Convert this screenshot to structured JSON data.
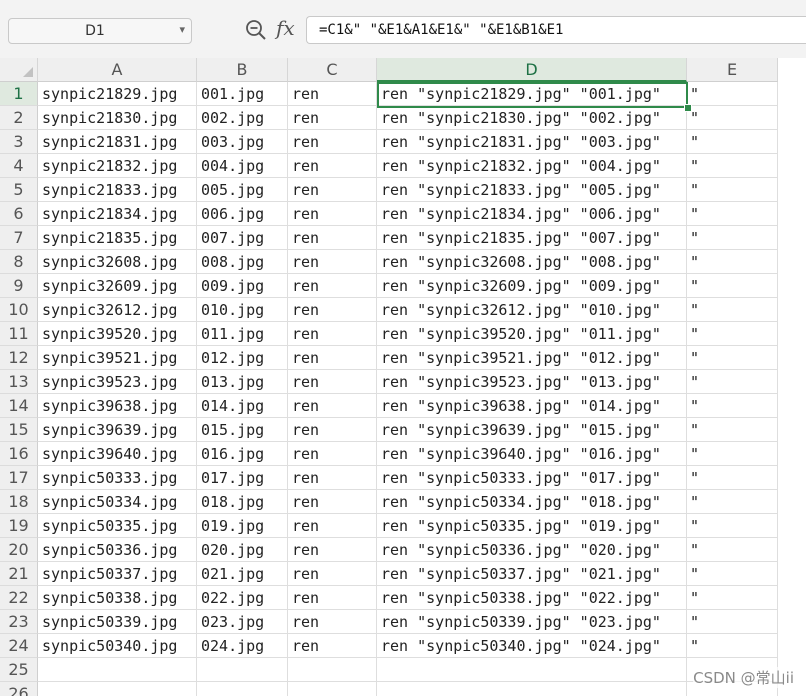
{
  "formula_bar": {
    "name_box": "D1",
    "formula": "=C1&\" \"&E1&A1&E1&\" \"&E1&B1&E1"
  },
  "columns": [
    "A",
    "B",
    "C",
    "D",
    "E"
  ],
  "selected_column": "D",
  "selected_row": "1",
  "rows": [
    {
      "n": "1",
      "a": "synpic21829.jpg",
      "b": "001.jpg",
      "c": "ren",
      "d": "ren \"synpic21829.jpg\" \"001.jpg\"",
      "e": "\""
    },
    {
      "n": "2",
      "a": "synpic21830.jpg",
      "b": "002.jpg",
      "c": "ren",
      "d": "ren \"synpic21830.jpg\" \"002.jpg\"",
      "e": "\""
    },
    {
      "n": "3",
      "a": "synpic21831.jpg",
      "b": "003.jpg",
      "c": "ren",
      "d": "ren \"synpic21831.jpg\" \"003.jpg\"",
      "e": "\""
    },
    {
      "n": "4",
      "a": "synpic21832.jpg",
      "b": "004.jpg",
      "c": "ren",
      "d": "ren \"synpic21832.jpg\" \"004.jpg\"",
      "e": "\""
    },
    {
      "n": "5",
      "a": "synpic21833.jpg",
      "b": "005.jpg",
      "c": "ren",
      "d": "ren \"synpic21833.jpg\" \"005.jpg\"",
      "e": "\""
    },
    {
      "n": "6",
      "a": "synpic21834.jpg",
      "b": "006.jpg",
      "c": "ren",
      "d": "ren \"synpic21834.jpg\" \"006.jpg\"",
      "e": "\""
    },
    {
      "n": "7",
      "a": "synpic21835.jpg",
      "b": "007.jpg",
      "c": "ren",
      "d": "ren \"synpic21835.jpg\" \"007.jpg\"",
      "e": "\""
    },
    {
      "n": "8",
      "a": "synpic32608.jpg",
      "b": "008.jpg",
      "c": "ren",
      "d": "ren \"synpic32608.jpg\" \"008.jpg\"",
      "e": "\""
    },
    {
      "n": "9",
      "a": "synpic32609.jpg",
      "b": "009.jpg",
      "c": "ren",
      "d": "ren \"synpic32609.jpg\" \"009.jpg\"",
      "e": "\""
    },
    {
      "n": "10",
      "a": "synpic32612.jpg",
      "b": "010.jpg",
      "c": "ren",
      "d": "ren \"synpic32612.jpg\" \"010.jpg\"",
      "e": "\""
    },
    {
      "n": "11",
      "a": "synpic39520.jpg",
      "b": "011.jpg",
      "c": "ren",
      "d": "ren \"synpic39520.jpg\" \"011.jpg\"",
      "e": "\""
    },
    {
      "n": "12",
      "a": "synpic39521.jpg",
      "b": "012.jpg",
      "c": "ren",
      "d": "ren \"synpic39521.jpg\" \"012.jpg\"",
      "e": "\""
    },
    {
      "n": "13",
      "a": "synpic39523.jpg",
      "b": "013.jpg",
      "c": "ren",
      "d": "ren \"synpic39523.jpg\" \"013.jpg\"",
      "e": "\""
    },
    {
      "n": "14",
      "a": "synpic39638.jpg",
      "b": "014.jpg",
      "c": "ren",
      "d": "ren \"synpic39638.jpg\" \"014.jpg\"",
      "e": "\""
    },
    {
      "n": "15",
      "a": "synpic39639.jpg",
      "b": "015.jpg",
      "c": "ren",
      "d": "ren \"synpic39639.jpg\" \"015.jpg\"",
      "e": "\""
    },
    {
      "n": "16",
      "a": "synpic39640.jpg",
      "b": "016.jpg",
      "c": "ren",
      "d": "ren \"synpic39640.jpg\" \"016.jpg\"",
      "e": "\""
    },
    {
      "n": "17",
      "a": "synpic50333.jpg",
      "b": "017.jpg",
      "c": "ren",
      "d": "ren \"synpic50333.jpg\" \"017.jpg\"",
      "e": "\""
    },
    {
      "n": "18",
      "a": "synpic50334.jpg",
      "b": "018.jpg",
      "c": "ren",
      "d": "ren \"synpic50334.jpg\" \"018.jpg\"",
      "e": "\""
    },
    {
      "n": "19",
      "a": "synpic50335.jpg",
      "b": "019.jpg",
      "c": "ren",
      "d": "ren \"synpic50335.jpg\" \"019.jpg\"",
      "e": "\""
    },
    {
      "n": "20",
      "a": "synpic50336.jpg",
      "b": "020.jpg",
      "c": "ren",
      "d": "ren \"synpic50336.jpg\" \"020.jpg\"",
      "e": "\""
    },
    {
      "n": "21",
      "a": "synpic50337.jpg",
      "b": "021.jpg",
      "c": "ren",
      "d": "ren \"synpic50337.jpg\" \"021.jpg\"",
      "e": "\""
    },
    {
      "n": "22",
      "a": "synpic50338.jpg",
      "b": "022.jpg",
      "c": "ren",
      "d": "ren \"synpic50338.jpg\" \"022.jpg\"",
      "e": "\""
    },
    {
      "n": "23",
      "a": "synpic50339.jpg",
      "b": "023.jpg",
      "c": "ren",
      "d": "ren \"synpic50339.jpg\" \"023.jpg\"",
      "e": "\""
    },
    {
      "n": "24",
      "a": "synpic50340.jpg",
      "b": "024.jpg",
      "c": "ren",
      "d": "ren \"synpic50340.jpg\" \"024.jpg\"",
      "e": "\""
    },
    {
      "n": "25",
      "a": "",
      "b": "",
      "c": "",
      "d": "",
      "e": ""
    },
    {
      "n": "26",
      "a": "",
      "b": "",
      "c": "",
      "d": "",
      "e": ""
    }
  ],
  "watermark": "CSDN @常山ii",
  "colors": {
    "accent": "#2f8a4a"
  }
}
